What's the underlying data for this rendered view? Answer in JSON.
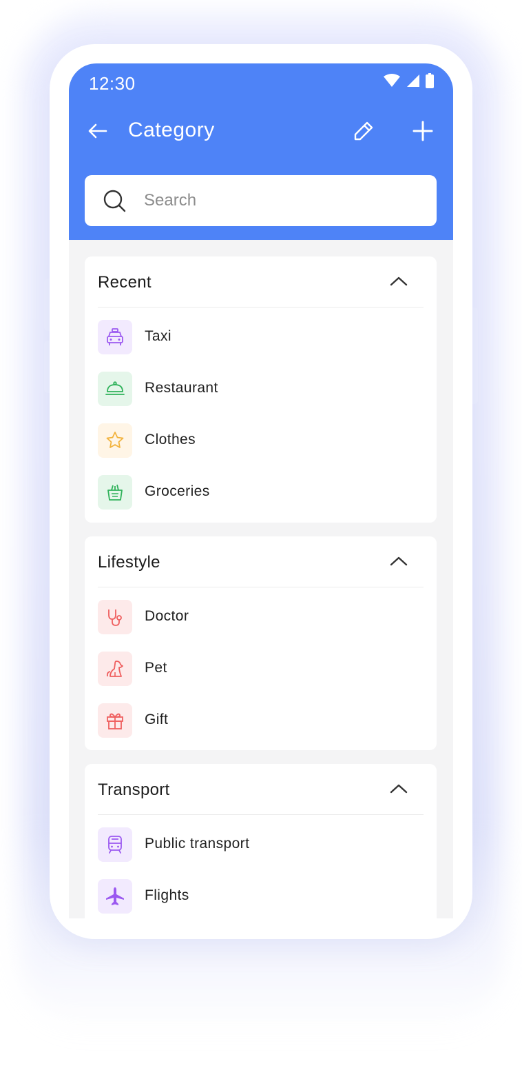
{
  "status": {
    "time": "12:30"
  },
  "appbar": {
    "title": "Category"
  },
  "search": {
    "placeholder": "Search"
  },
  "colors": {
    "header": "#4e83f7",
    "purple": "#9b59f0",
    "green": "#2fb25a",
    "yellow": "#f2b33d",
    "red": "#ef5f5f"
  },
  "sections": [
    {
      "title": "Recent",
      "items": [
        {
          "label": "Taxi",
          "icon": "taxi-icon"
        },
        {
          "label": "Restaurant",
          "icon": "cloche-icon"
        },
        {
          "label": "Clothes",
          "icon": "star-icon"
        },
        {
          "label": "Groceries",
          "icon": "grocery-basket-icon"
        }
      ]
    },
    {
      "title": "Lifestyle",
      "items": [
        {
          "label": "Doctor",
          "icon": "stethoscope-icon"
        },
        {
          "label": "Pet",
          "icon": "dog-icon"
        },
        {
          "label": "Gift",
          "icon": "gift-icon"
        }
      ]
    },
    {
      "title": "Transport",
      "items": [
        {
          "label": "Public transport",
          "icon": "bus-icon"
        },
        {
          "label": "Flights",
          "icon": "airplane-icon"
        }
      ]
    }
  ]
}
